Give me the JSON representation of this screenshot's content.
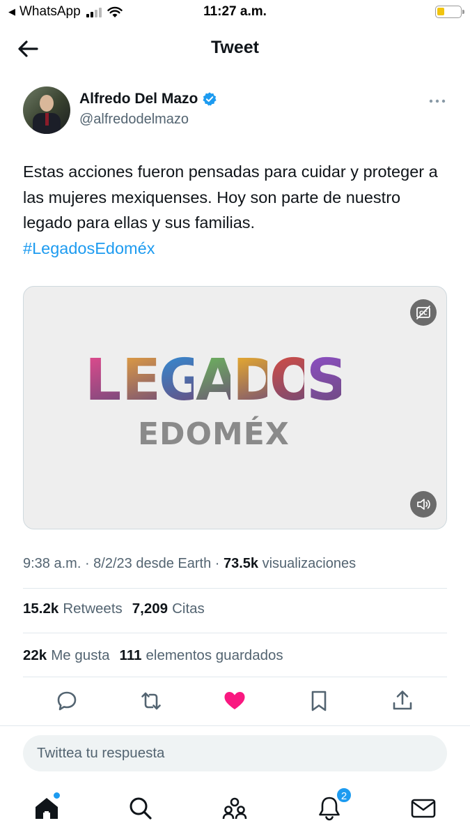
{
  "status_bar": {
    "back_app": "WhatsApp",
    "time": "11:27 a.m."
  },
  "header": {
    "title": "Tweet"
  },
  "tweet": {
    "author_name": "Alfredo Del Mazo",
    "author_handle": "@alfredodelmazo",
    "text": "Estas acciones fueron pensadas para cuidar y proteger a las mujeres mexiquenses. Hoy son parte de nuestro legado para ellas y sus familias.",
    "hashtag": "#LegadosEdoméx",
    "media": {
      "title_word": "LEGADOS",
      "subtitle_word": "EDOMÉX",
      "letters": [
        "L",
        "E",
        "G",
        "A",
        "D",
        "O",
        "S"
      ],
      "letter_colors": [
        "#e84a8e",
        "#e8a33d",
        "#2f8fd8",
        "#6bbf59",
        "#f2b327",
        "#d94d3f",
        "#8e4fc9"
      ]
    },
    "meta": {
      "time": "9:38 a.m.",
      "date": "8/2/23",
      "source": "desde Earth",
      "views_count": "73.5k",
      "views_label": "visualizaciones"
    },
    "stats": {
      "retweets_count": "15.2k",
      "retweets_label": "Retweets",
      "quotes_count": "7,209",
      "quotes_label": "Citas",
      "likes_count": "22k",
      "likes_label": "Me gusta",
      "bookmarks_count": "111",
      "bookmarks_label": "elementos guardados"
    },
    "liked": true
  },
  "reply": {
    "placeholder": "Twittea tu respuesta"
  },
  "bottom_nav": {
    "notifications_badge": "2"
  },
  "colors": {
    "accent": "#1d9bf0",
    "like": "#f91880",
    "text_secondary": "#536471"
  },
  "icons": [
    "arrow-left-icon",
    "verified-icon",
    "more-icon",
    "captions-icon",
    "volume-icon",
    "reply-icon",
    "retweet-icon",
    "heart-icon",
    "bookmark-icon",
    "share-icon",
    "home-icon",
    "search-icon",
    "communities-icon",
    "bell-icon",
    "mail-icon"
  ]
}
